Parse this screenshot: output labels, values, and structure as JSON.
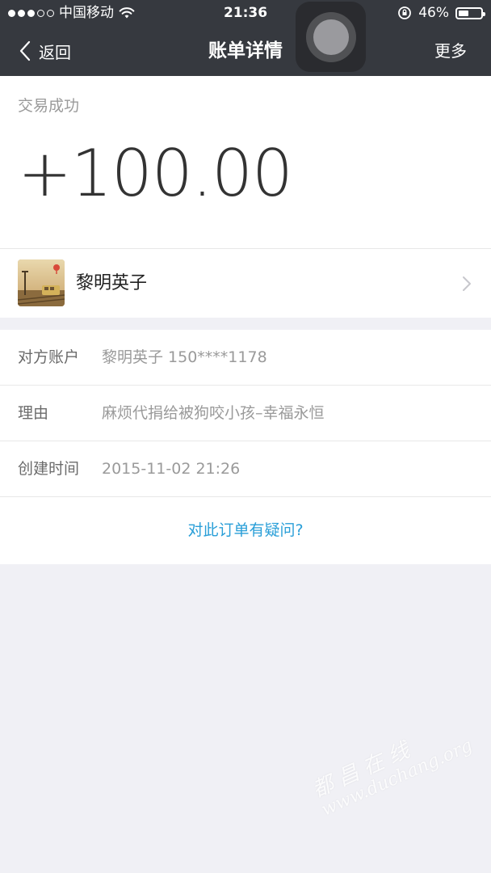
{
  "status_bar": {
    "carrier": "中国移动",
    "time": "21:36",
    "battery": "46%",
    "battery_level": 0.46,
    "signal_filled": 3,
    "signal_total": 5
  },
  "nav": {
    "back_label": "返回",
    "title": "账单详情",
    "more_label": "更多"
  },
  "transaction": {
    "status": "交易成功",
    "amount": "+100.00"
  },
  "counterparty": {
    "name": "黎明英子"
  },
  "details": {
    "rows": [
      {
        "label": "对方账户",
        "value": "黎明英子 150****1178"
      },
      {
        "label": "理由",
        "value": "麻烦代捐给被狗咬小孩–幸福永恒"
      },
      {
        "label": "创建时间",
        "value": "2015-11-02 21:26"
      }
    ],
    "question_link": "对此订单有疑问?"
  },
  "watermark": {
    "cn": "都昌在线",
    "en": "www.duchang.org"
  },
  "colors": {
    "nav_bg": "#36393f",
    "link": "#2a9fd8",
    "page_bg": "#f0f0f5"
  }
}
